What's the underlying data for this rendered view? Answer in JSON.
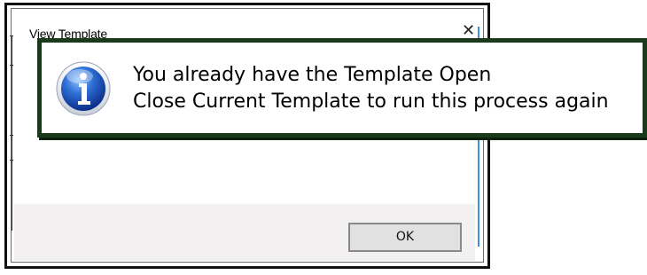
{
  "dialog": {
    "title": "View Template",
    "close_symbol": "✕",
    "ok_label": "OK"
  },
  "message": {
    "icon": "info-icon",
    "line1": "You already have the Template Open",
    "line2": "Close Current Template to run this process again"
  },
  "colors": {
    "frame": "#111111",
    "panel_border": "#1b3a1b",
    "accent_blue": "#3e8fe0",
    "footer_bg": "#f3f0f2",
    "button_bg": "#e1e1e1"
  }
}
